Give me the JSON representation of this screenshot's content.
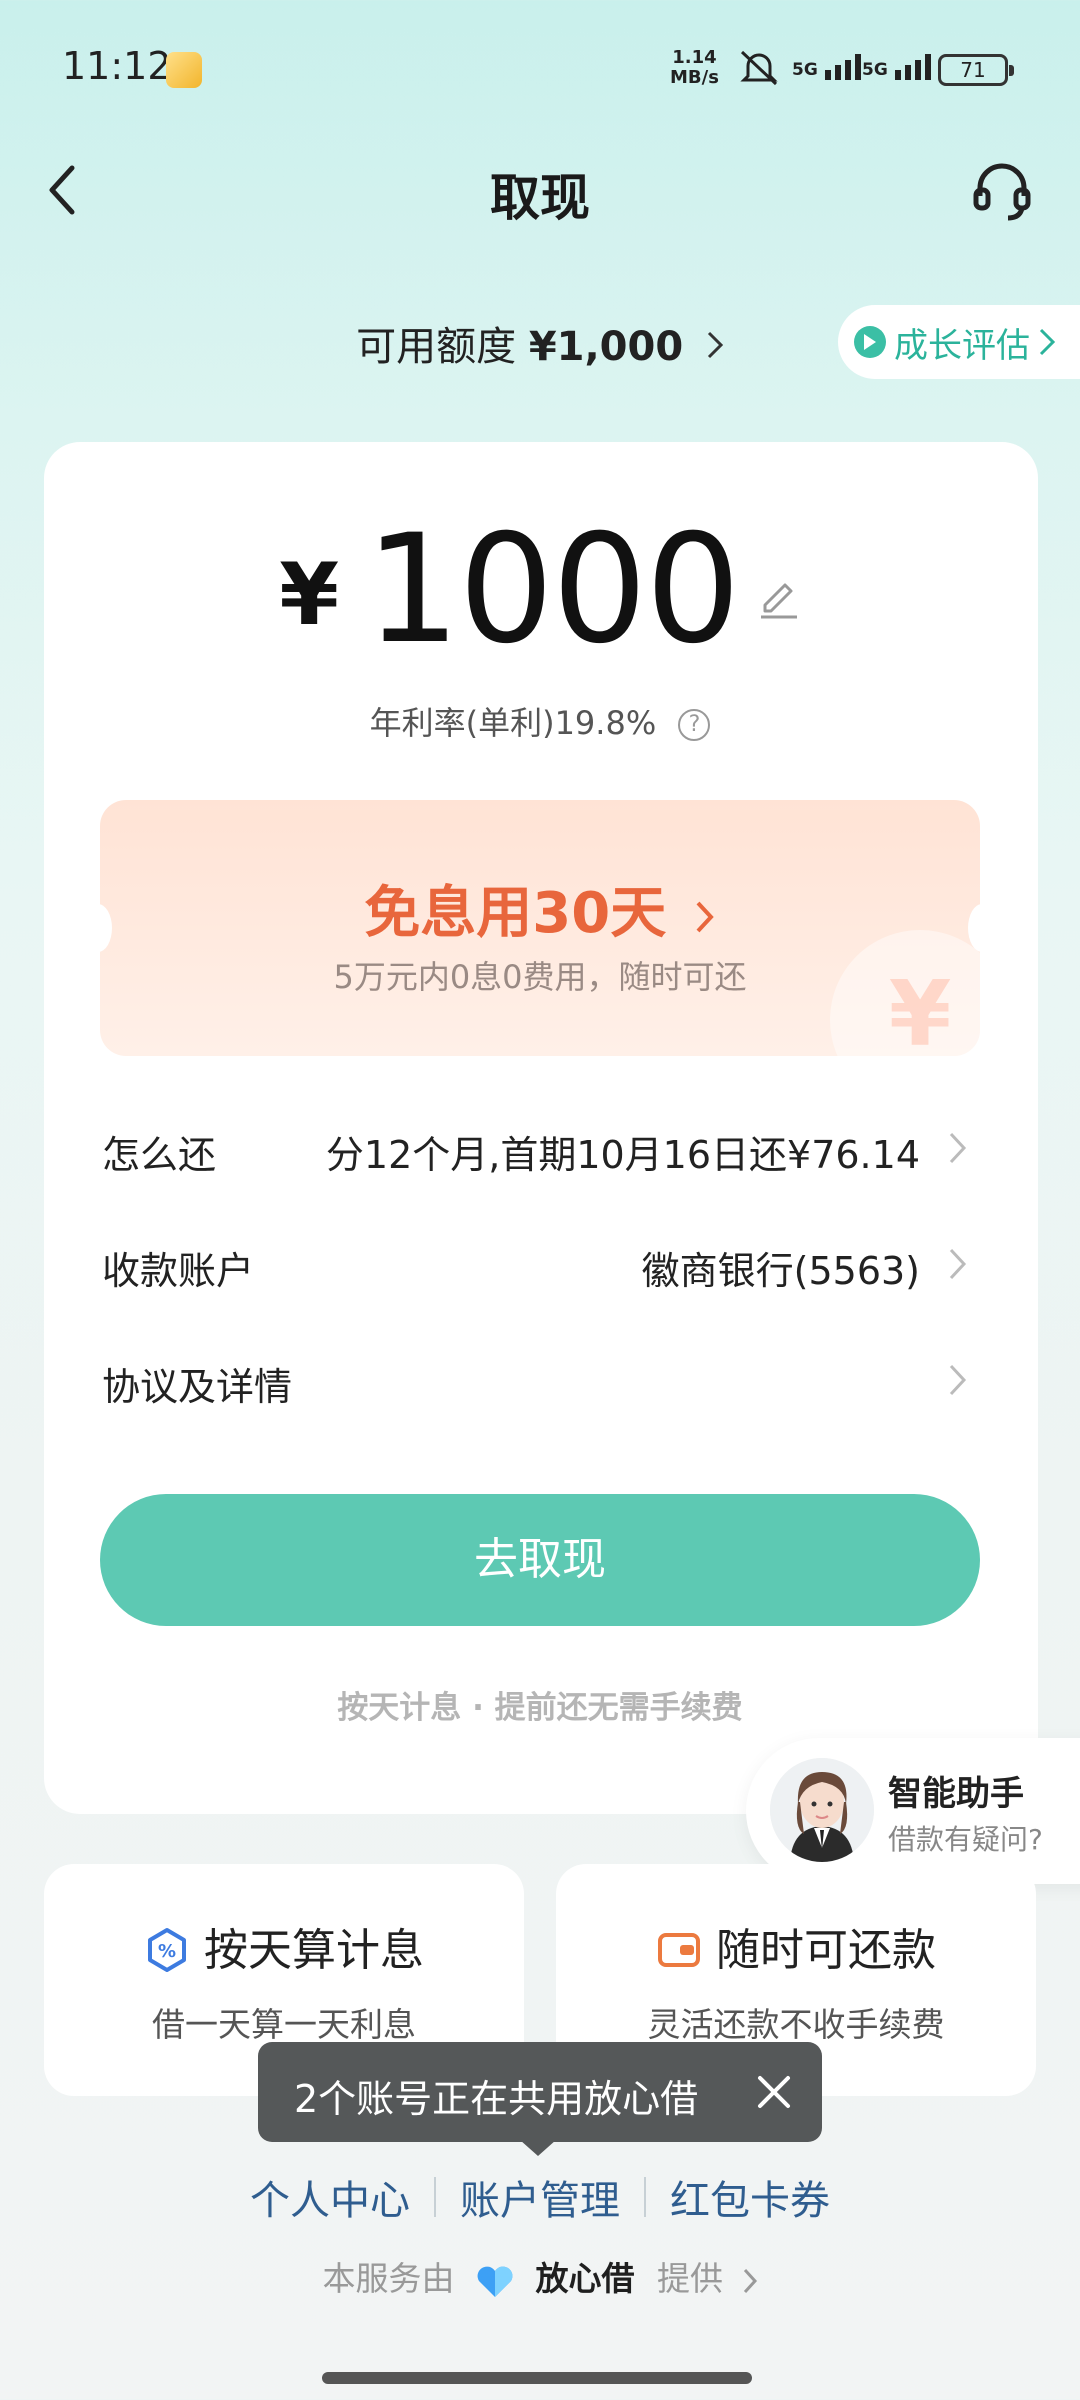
{
  "status_bar": {
    "time": "11:12",
    "net_speed_value": "1.14",
    "net_speed_unit": "MB/s",
    "sig1_label": "5G",
    "sig2_label": "5G",
    "battery": "71"
  },
  "nav": {
    "title": "取现"
  },
  "credit": {
    "label": "可用额度",
    "amount": "¥1,000",
    "growth_label": "成长评估"
  },
  "withdraw": {
    "currency": "¥",
    "amount": "1000",
    "rate_text": "年利率(单利)19.8%",
    "help_icon": "?"
  },
  "promo": {
    "title": "免息用30天",
    "subtitle": "5万元内0息0费用，随时可还",
    "coin_symbol": "¥"
  },
  "rows": {
    "repay_label": "怎么还",
    "repay_value": "分12个月,首期10月16日还¥76.14",
    "account_label": "收款账户",
    "account_value": "徽商银行(5563)",
    "agreement_label": "协议及详情"
  },
  "cta": {
    "button_label": "去取现",
    "fee_note": "按天计息 · 提前还无需手续费"
  },
  "assistant": {
    "name": "智能助手",
    "subtitle": "借款有疑问?"
  },
  "features": [
    {
      "title": "按天算计息",
      "subtitle": "借一天算一天利息",
      "icon": "percent-icon"
    },
    {
      "title": "随时可还款",
      "subtitle": "灵活还款不收手续费",
      "icon": "wallet-icon"
    }
  ],
  "toast": {
    "text": "2个账号正在共用放心借"
  },
  "bottom_links": [
    "个人中心",
    "账户管理",
    "红包卡券"
  ],
  "provider": {
    "prefix": "本服务由",
    "brand": "放心借",
    "suffix": "提供"
  },
  "colors": {
    "accent": "#5dc9b3",
    "promo_orange": "#e8663c",
    "link_blue": "#2f5d8f"
  }
}
